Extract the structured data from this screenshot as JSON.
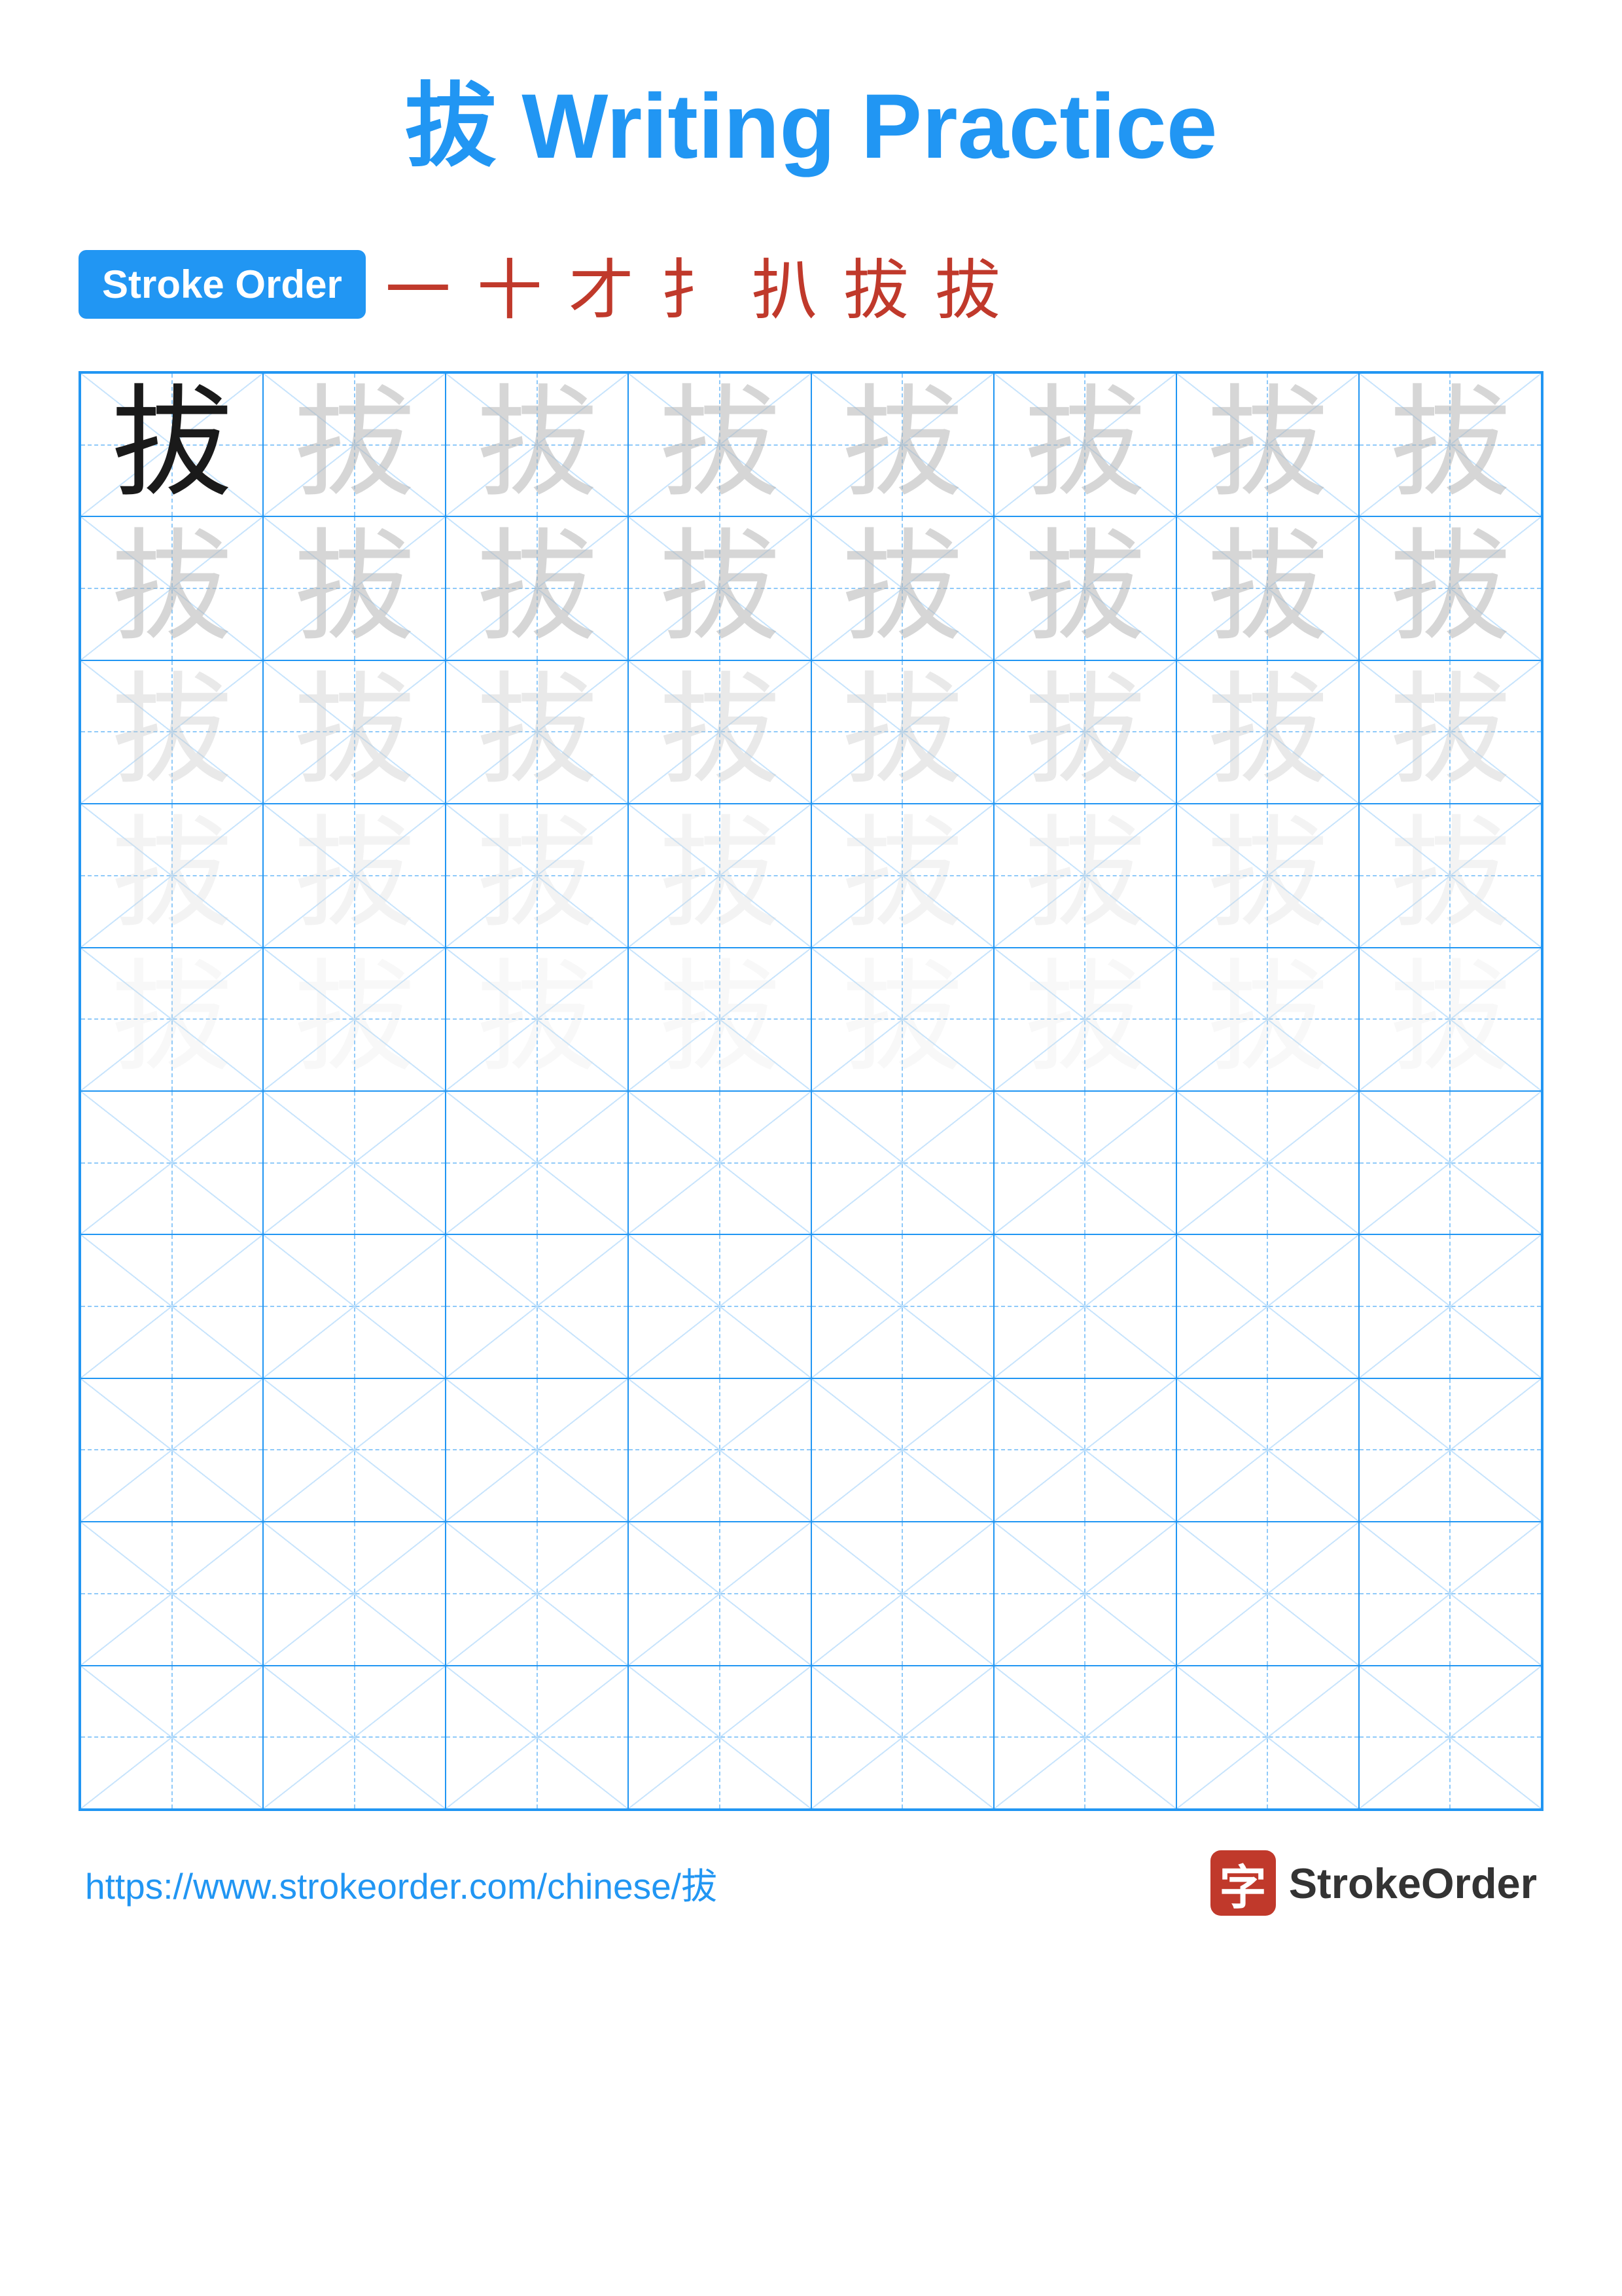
{
  "title": {
    "char": "拔",
    "suffix": " Writing Practice"
  },
  "stroke_order": {
    "badge_label": "Stroke Order",
    "strokes": [
      "一",
      "十",
      "才",
      "扌",
      "扒",
      "拔",
      "拔"
    ]
  },
  "grid": {
    "cols": 8,
    "rows": 10,
    "char": "拔",
    "char_rows": [
      {
        "type": "dark",
        "count": 1,
        "empty": 7
      },
      {
        "type": "light1",
        "count": 8
      },
      {
        "type": "light2",
        "count": 8
      },
      {
        "type": "light3",
        "count": 8
      },
      {
        "type": "light4",
        "count": 8
      },
      {
        "type": "empty",
        "count": 8
      },
      {
        "type": "empty",
        "count": 8
      },
      {
        "type": "empty",
        "count": 8
      },
      {
        "type": "empty",
        "count": 8
      },
      {
        "type": "empty",
        "count": 8
      }
    ]
  },
  "footer": {
    "url": "https://www.strokeorder.com/chinese/拔",
    "logo_char": "字",
    "logo_text": "StrokeOrder"
  }
}
